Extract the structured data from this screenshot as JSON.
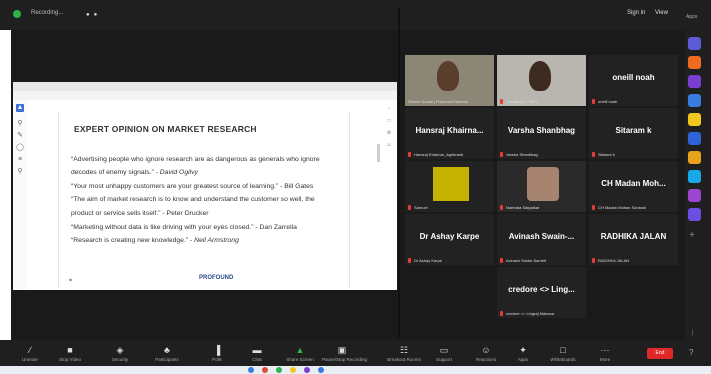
{
  "topbar": {
    "recording": "Recording...",
    "signin": "Sign in",
    "view": "View",
    "apps": "Apps"
  },
  "shared": {
    "heading": "EXPERT OPINION ON MARKET RESEARCH",
    "quotes": [
      {
        "text": "“Advertising people who ignore research are as dangerous as generals who ignore",
        "cite": ""
      },
      {
        "text": "decodes of enemy signals.” - ",
        "cite": "David Ogilvy"
      },
      {
        "text": "“Your most unhappy customers are your greatest source of learning.” - Bill Gates",
        "cite": ""
      },
      {
        "text": "“The aim of market research is to know and understand the customer so well, the",
        "cite": ""
      },
      {
        "text": "product or service sells itself.” - Peter Drucker",
        "cite": ""
      },
      {
        "text": "“Marketing without data is like driving with your eyes closed.” - Dan Zarrella",
        "cite": ""
      },
      {
        "text": "“Research is creating new knowledge.” - ",
        "cite": "Neil Armstrong"
      }
    ],
    "logo": "PROFOUND"
  },
  "participants": [
    {
      "name": "",
      "label": "Dinesh Kodali | Profound Edutech",
      "video": "person1",
      "speaking": true,
      "mic": false
    },
    {
      "name": "",
      "label": "Tushar (AIC-NEP)",
      "video": "person2",
      "speaking": false,
      "mic": true
    },
    {
      "name": "oneill noah",
      "label": "oneill noah",
      "video": "",
      "speaking": false,
      "mic": true
    },
    {
      "name": "Hansraj Khairna...",
      "label": "Hansraj Khairnar_Agrikranti",
      "video": "",
      "speaking": false,
      "mic": true
    },
    {
      "name": "Varsha Shanbhag",
      "label": "Varsha Shanbhag",
      "video": "",
      "speaking": false,
      "mic": true
    },
    {
      "name": "Sitaram k",
      "label": "Sitaram k",
      "video": "",
      "speaking": false,
      "mic": true
    },
    {
      "name": "",
      "label": "Samuel",
      "video": "yellow",
      "speaking": false,
      "mic": true
    },
    {
      "name": "",
      "label": "Namrata Satpalkar",
      "video": "person3",
      "speaking": false,
      "mic": true
    },
    {
      "name": "CH Madan Moh...",
      "label": "CH Madan Mohan Santosh",
      "video": "",
      "speaking": false,
      "mic": true
    },
    {
      "name": "Dr Ashay Karpe",
      "label": "Dr Ashay Karpe",
      "video": "",
      "speaking": false,
      "mic": true
    },
    {
      "name": "Avinash Swain-...",
      "label": "Avinash Swain-Sambit",
      "video": "",
      "speaking": false,
      "mic": true
    },
    {
      "name": "RADHIKA JALAN",
      "label": "RADHIKA JALAN",
      "video": "",
      "speaking": false,
      "mic": true
    },
    {
      "name": "credore <> Ling...",
      "label": "credore <> Lingraj Mahana",
      "video": "",
      "speaking": false,
      "mic": true
    }
  ],
  "toolbar": [
    {
      "id": "unmute",
      "label": "Unmute",
      "icon": "mic-off-icon",
      "glyph": "∕"
    },
    {
      "id": "stop-video",
      "label": "Stop Video",
      "icon": "video-icon",
      "glyph": "■"
    },
    {
      "id": "security",
      "label": "Security",
      "icon": "shield-icon",
      "glyph": "◈"
    },
    {
      "id": "participants",
      "label": "Participants",
      "icon": "people-icon",
      "glyph": "♣"
    },
    {
      "id": "polls",
      "label": "Polls",
      "icon": "bar-chart-icon",
      "glyph": "▐"
    },
    {
      "id": "chat",
      "label": "Chat",
      "icon": "chat-icon",
      "glyph": "▬"
    },
    {
      "id": "share-screen",
      "label": "Share Screen",
      "icon": "share-screen-icon",
      "glyph": "▲"
    },
    {
      "id": "recording",
      "label": "Pause/Stop Recording",
      "icon": "record-icon",
      "glyph": "▣"
    },
    {
      "id": "breakout",
      "label": "Breakout Rooms",
      "icon": "grid-icon",
      "glyph": "☷"
    },
    {
      "id": "support",
      "label": "Support",
      "icon": "support-icon",
      "glyph": "▭"
    },
    {
      "id": "reactions",
      "label": "Reactions",
      "icon": "reaction-icon",
      "glyph": "☺"
    },
    {
      "id": "apps",
      "label": "Apps",
      "icon": "apps-icon",
      "glyph": "✦"
    },
    {
      "id": "whiteboards",
      "label": "Whiteboards",
      "icon": "whiteboard-icon",
      "glyph": "□"
    },
    {
      "id": "more",
      "label": "More",
      "icon": "more-icon",
      "glyph": "···"
    }
  ],
  "end": "End",
  "colors": {
    "accent": "#2db34a",
    "end": "#e02828",
    "speaking": "#d8d93a",
    "brand": "#2c4a8a"
  }
}
